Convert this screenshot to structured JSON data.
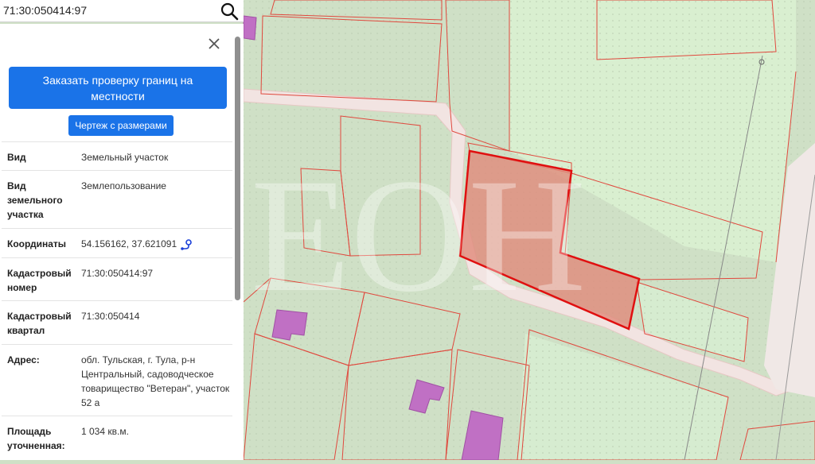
{
  "search": {
    "value": "71:30:050414:97"
  },
  "panel": {
    "order_check_button": "Заказать проверку границ на местности",
    "drawing_button": "Чертеж с размерами",
    "rows": [
      {
        "label": "Вид",
        "value": "Земельный участок"
      },
      {
        "label": "Вид земельного участка",
        "value": "Землепользование"
      },
      {
        "label": "Координаты",
        "value": "54.156162, 37.621091"
      },
      {
        "label": "Кадастровый номер",
        "value": "71:30:050414:97"
      },
      {
        "label": "Кадастровый квартал",
        "value": "71:30:050414"
      },
      {
        "label": "Адрес:",
        "value": "обл. Тульская, г. Тула, р-н Центральный, садоводческое товарищество \"Ветеран\", участок 52 а"
      },
      {
        "label": "Площадь уточненная:",
        "value": "1 034 кв.м."
      }
    ]
  },
  "map": {
    "watermark": "ЕОН"
  },
  "colors": {
    "accent": "#1a73e8",
    "map_background": "#cfe0c6",
    "parcel_border": "#e0483d",
    "selected_parcel_border": "#e01010",
    "building": "#c070c4",
    "road": "#f2e4e2"
  },
  "icons": [
    "search-icon",
    "close-icon",
    "map-pin-route-icon"
  ]
}
